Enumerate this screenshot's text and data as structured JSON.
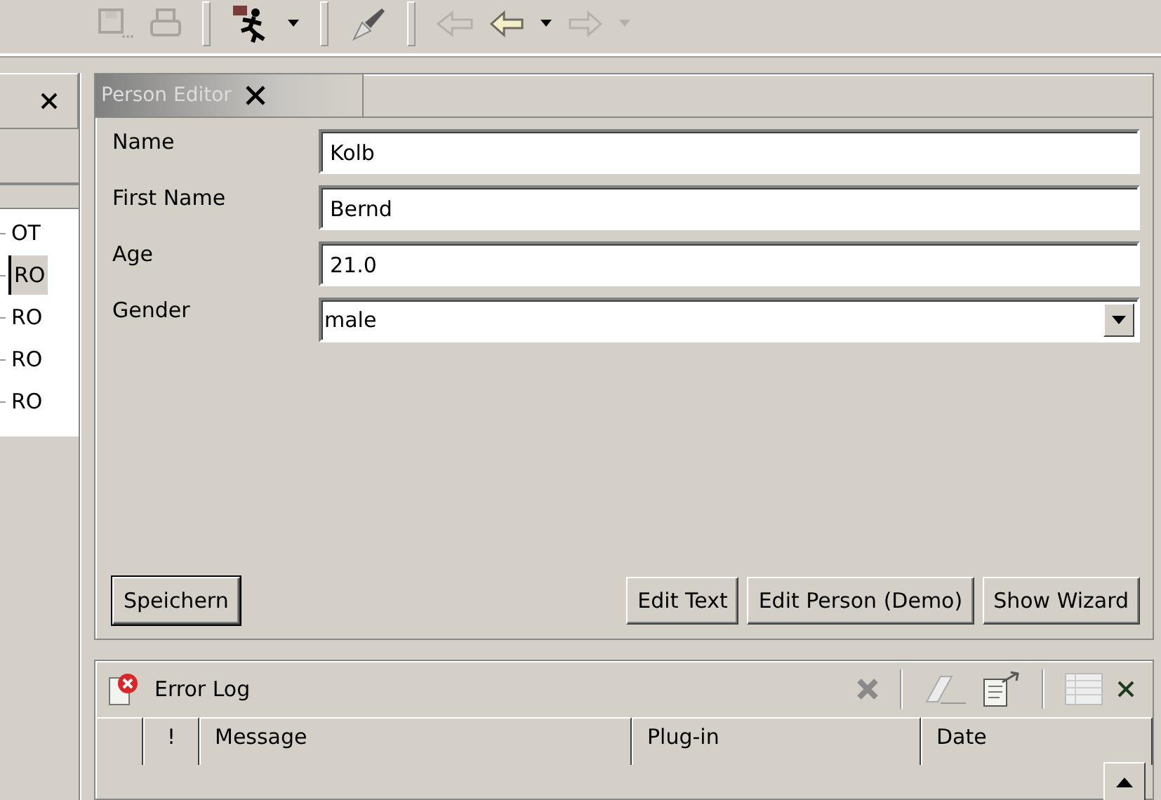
{
  "left_view": {
    "items": [
      {
        "label": "OT",
        "selected": false
      },
      {
        "label": "RO",
        "selected": true
      },
      {
        "label": "RO",
        "selected": false
      },
      {
        "label": "RO",
        "selected": false
      },
      {
        "label": "RO",
        "selected": false
      }
    ]
  },
  "editor": {
    "tab": {
      "title": "Person Editor"
    },
    "fields": [
      {
        "kind": "text",
        "label": "Name",
        "value": "Kolb"
      },
      {
        "kind": "text",
        "label": "First Name",
        "value": "Bernd"
      },
      {
        "kind": "text",
        "label": "Age",
        "value": "21.0"
      },
      {
        "kind": "combo",
        "label": "Gender",
        "value": "male"
      }
    ],
    "buttons": [
      {
        "label": "Speichern",
        "default": true
      },
      {
        "label": "Edit Text",
        "default": false
      },
      {
        "label": "Edit Person (Demo)",
        "default": false
      },
      {
        "label": "Show Wizard",
        "default": false
      }
    ]
  },
  "error_log": {
    "title": "Error Log",
    "columns": [
      {
        "label": "!"
      },
      {
        "label": "Message"
      },
      {
        "label": "Plug-in"
      },
      {
        "label": "Date"
      }
    ]
  }
}
